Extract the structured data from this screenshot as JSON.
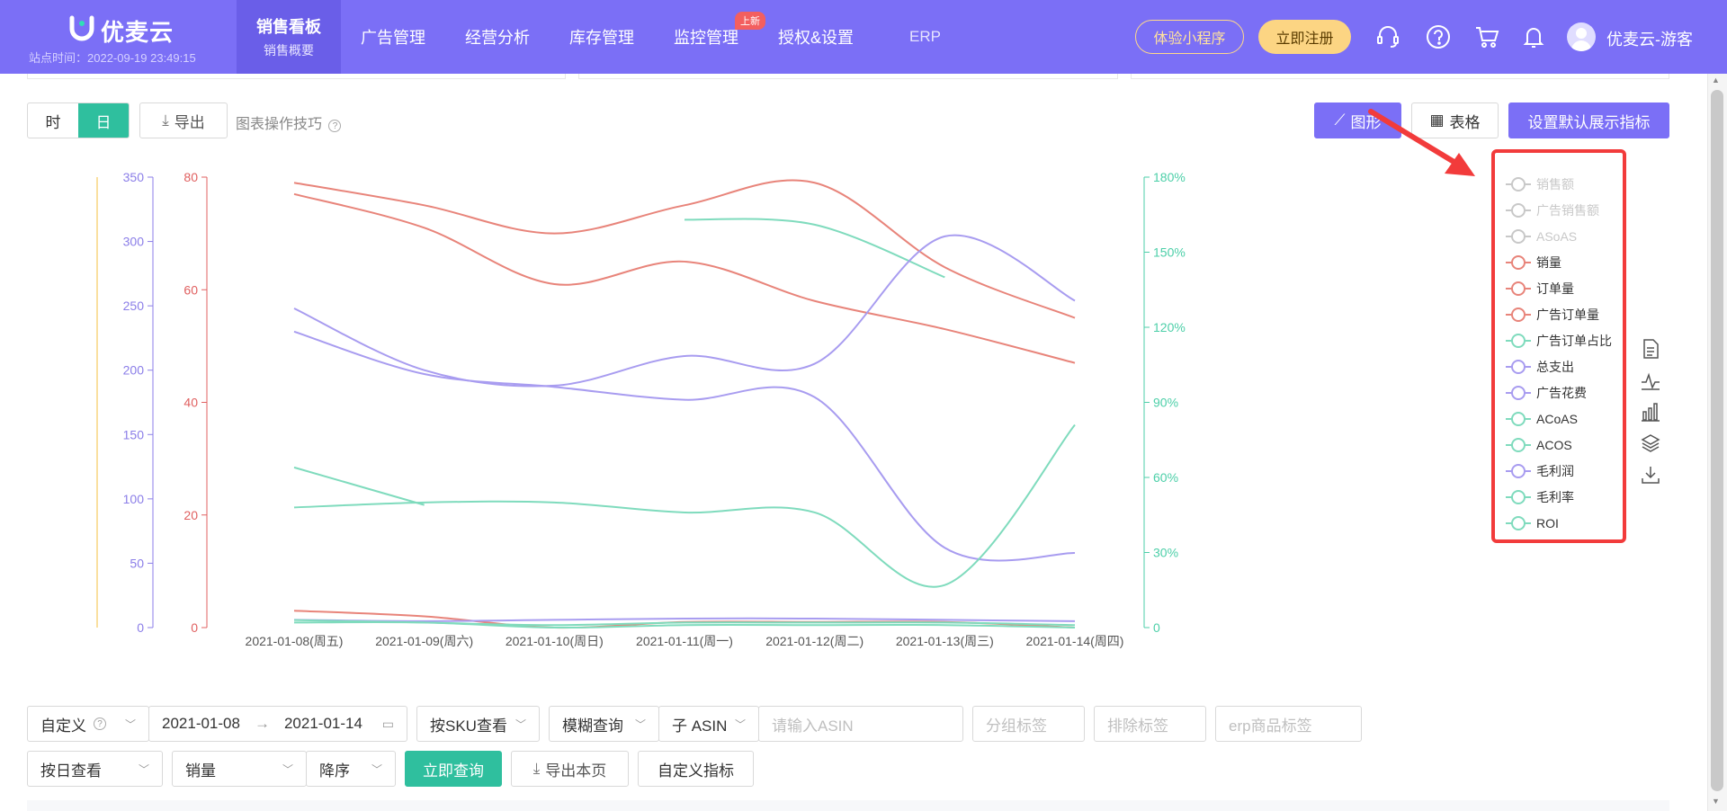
{
  "header": {
    "logo_text": "优麦云",
    "site_time": "站点时间：2022-09-19 23:49:15",
    "nav": [
      {
        "label": "销售看板",
        "sub": "销售概要"
      },
      {
        "label": "广告管理"
      },
      {
        "label": "经营分析"
      },
      {
        "label": "库存管理"
      },
      {
        "label": "监控管理",
        "badge": "上新"
      },
      {
        "label": "授权&设置"
      },
      {
        "label": "ERP"
      }
    ],
    "trial_button": "体验小程序",
    "register_button": "立即注册",
    "user_name": "优麦云-游客",
    "icons": [
      "service-icon",
      "help-icon",
      "cart-icon",
      "bell-icon"
    ]
  },
  "toolbar": {
    "hour": "时",
    "day": "日",
    "export": "导出",
    "tips": "图表操作技巧",
    "graph": "图形",
    "table": "表格",
    "set_default": "设置默认展示指标"
  },
  "chart_data": {
    "type": "line",
    "categories": [
      "2021-01-08(周五)",
      "2021-01-09(周六)",
      "2021-01-10(周日)",
      "2021-01-11(周一)",
      "2021-01-12(周二)",
      "2021-01-13(周三)",
      "2021-01-14(周四)"
    ],
    "axes": {
      "y_orange": {
        "ticks": [],
        "color": "#f5c242"
      },
      "y_purple": {
        "ticks": [
          "0",
          "50",
          "100",
          "150",
          "200",
          "250",
          "300",
          "350"
        ],
        "ylim": [
          0,
          350
        ],
        "color": "#8b7ee8"
      },
      "y_red": {
        "ticks": [
          "0",
          "20",
          "40",
          "60",
          "80"
        ],
        "ylim": [
          0,
          80
        ],
        "color": "#e06060"
      },
      "y_green": {
        "ticks": [
          "0",
          "30%",
          "60%",
          "90%",
          "120%",
          "150%",
          "180%"
        ],
        "ylim": [
          0,
          180
        ],
        "color": "#4ccfa8"
      }
    },
    "series": [
      {
        "name": "销量",
        "axis": "red",
        "color": "#e8847a",
        "values": [
          79,
          75,
          70,
          75,
          79,
          64,
          55
        ]
      },
      {
        "name": "订单量",
        "axis": "red",
        "color": "#e8847a",
        "values": [
          77,
          71,
          61,
          65,
          58,
          53,
          47
        ]
      },
      {
        "name": "广告订单量",
        "axis": "red",
        "color": "#e8847a",
        "values": [
          3,
          2,
          0,
          1,
          1,
          1,
          0
        ]
      },
      {
        "name": "广告订单占比",
        "axis": "green",
        "color": "#7fdbbd",
        "values": [
          null,
          null,
          null,
          163,
          161,
          140,
          null
        ]
      },
      {
        "name": "总支出",
        "axis": "purple",
        "color": "#a89cf0",
        "values": [
          248,
          200,
          188,
          211,
          205,
          304,
          254
        ]
      },
      {
        "name": "广告花费",
        "axis": "purple",
        "color": "#a89cf0",
        "values": [
          230,
          197,
          187,
          177,
          179,
          62,
          58
        ]
      },
      {
        "name": "ACoAS",
        "axis": "green",
        "color": "#7fdbbd",
        "values": [
          64,
          49,
          null,
          null,
          null,
          null,
          null
        ]
      },
      {
        "name": "ACOS",
        "axis": "green",
        "color": "#7fdbbd",
        "values": [
          48,
          50,
          50,
          46,
          46,
          17,
          81
        ]
      },
      {
        "name": "毛利润",
        "axis": "purple",
        "color": "#a89cf0",
        "values": [
          6,
          5,
          6,
          7,
          7,
          6,
          5
        ]
      },
      {
        "name": "毛利率",
        "axis": "green",
        "color": "#7fdbbd",
        "values": [
          3,
          2,
          1,
          2,
          2,
          2,
          1
        ]
      },
      {
        "name": "ROI",
        "axis": "green",
        "color": "#7fdbbd",
        "values": [
          2,
          2,
          0,
          1,
          1,
          1,
          0
        ]
      }
    ],
    "legend": [
      {
        "label": "销售额",
        "color": "#c8c8c8",
        "disabled": true
      },
      {
        "label": "广告销售额",
        "color": "#c8c8c8",
        "disabled": true
      },
      {
        "label": "ASoAS",
        "color": "#c8c8c8",
        "disabled": true
      },
      {
        "label": "销量",
        "color": "#e8847a"
      },
      {
        "label": "订单量",
        "color": "#e8847a"
      },
      {
        "label": "广告订单量",
        "color": "#e8847a"
      },
      {
        "label": "广告订单占比",
        "color": "#7fdbbd"
      },
      {
        "label": "总支出",
        "color": "#a89cf0"
      },
      {
        "label": "广告花费",
        "color": "#a89cf0"
      },
      {
        "label": "ACoAS",
        "color": "#7fdbbd"
      },
      {
        "label": "ACOS",
        "color": "#7fdbbd"
      },
      {
        "label": "毛利润",
        "color": "#a89cf0"
      },
      {
        "label": "毛利率",
        "color": "#7fdbbd"
      },
      {
        "label": "ROI",
        "color": "#7fdbbd"
      }
    ],
    "legend_placement": "right"
  },
  "side_tools": [
    "data-view-icon",
    "line-chart-icon",
    "bar-chart-icon",
    "stack-icon",
    "download-icon"
  ],
  "filters": {
    "date_mode": "自定义",
    "start_date": "2021-01-08",
    "end_date": "2021-01-14",
    "view_by": "按SKU查看",
    "fuzzy": "模糊查询",
    "asin_type": "子 ASIN",
    "asin_placeholder": "请输入ASIN",
    "group_tag": "分组标签",
    "exclude_tag": "排除标签",
    "erp_tag": "erp商品标签",
    "granularity": "按日查看",
    "sort_field": "销量",
    "sort_order": "降序",
    "query_button": "立即查询",
    "export_page": "导出本页",
    "custom_metrics": "自定义指标"
  }
}
